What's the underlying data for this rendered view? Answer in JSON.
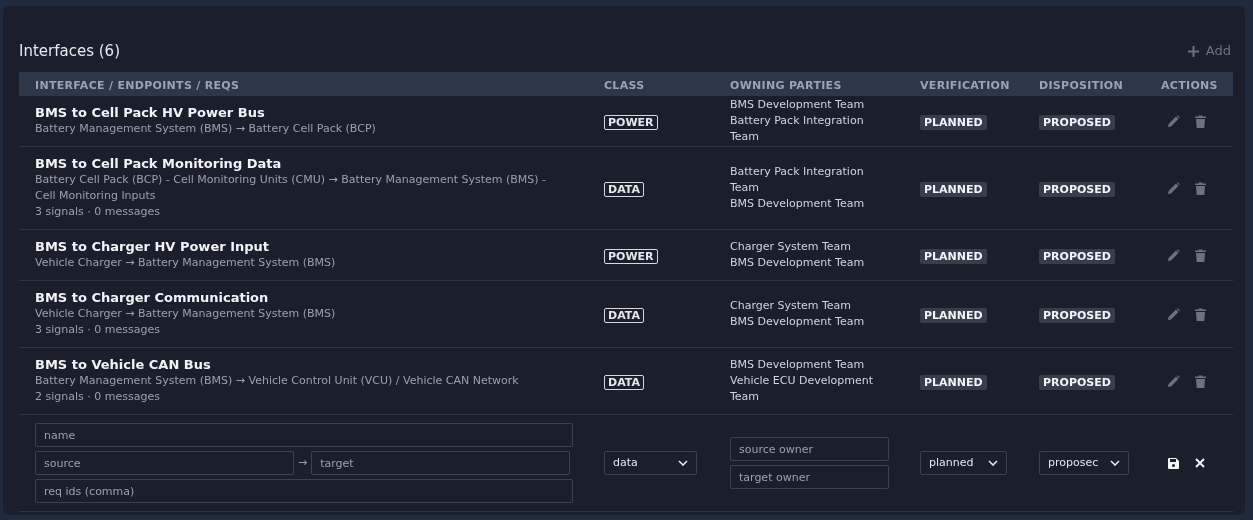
{
  "title": "Interfaces (6)",
  "add_button": {
    "label": "Add"
  },
  "columns": [
    "INTERFACE / ENDPOINTS / REQS",
    "CLASS",
    "OWNING PARTIES",
    "VERIFICATION",
    "DISPOSITION",
    "ACTIONS"
  ],
  "rows": [
    {
      "name": "BMS to Cell Pack HV Power Bus",
      "endpoints": "Battery Management System (BMS) → Battery Cell Pack (BCP)",
      "class": "POWER",
      "owners": [
        "BMS Development Team",
        "Battery Pack Integration Team"
      ],
      "verification": "PLANNED",
      "disposition": "PROPOSED"
    },
    {
      "name": "BMS to Cell Pack Monitoring Data",
      "endpoints": "Battery Cell Pack (BCP) - Cell Monitoring Units (CMU) → Battery Management System (BMS) - Cell Monitoring Inputs",
      "counts": "3 signals · 0 messages",
      "class": "DATA",
      "owners": [
        "Battery Pack Integration Team",
        "BMS Development Team"
      ],
      "verification": "PLANNED",
      "disposition": "PROPOSED"
    },
    {
      "name": "BMS to Charger HV Power Input",
      "endpoints": "Vehicle Charger → Battery Management System (BMS)",
      "class": "POWER",
      "owners": [
        "Charger System Team",
        "BMS Development Team"
      ],
      "verification": "PLANNED",
      "disposition": "PROPOSED"
    },
    {
      "name": "BMS to Charger Communication",
      "endpoints": "Vehicle Charger → Battery Management System (BMS)",
      "counts": "3 signals · 0 messages",
      "class": "DATA",
      "owners": [
        "Charger System Team",
        "BMS Development Team"
      ],
      "verification": "PLANNED",
      "disposition": "PROPOSED"
    },
    {
      "name": "BMS to Vehicle CAN Bus",
      "endpoints": "Battery Management System (BMS) → Vehicle Control Unit (VCU) / Vehicle CAN Network",
      "counts": "2 signals · 0 messages",
      "class": "DATA",
      "owners": [
        "BMS Development Team",
        "Vehicle ECU Development Team"
      ],
      "verification": "PLANNED",
      "disposition": "PROPOSED"
    }
  ],
  "new_row": {
    "name_placeholder": "name",
    "source_placeholder": "source",
    "arrow": "→",
    "target_placeholder": "target",
    "reqs_placeholder": "req ids (comma)",
    "class_value": "data",
    "source_owner_placeholder": "source owner",
    "target_owner_placeholder": "target owner",
    "verification_value": "planned",
    "disposition_value": "proposec"
  }
}
